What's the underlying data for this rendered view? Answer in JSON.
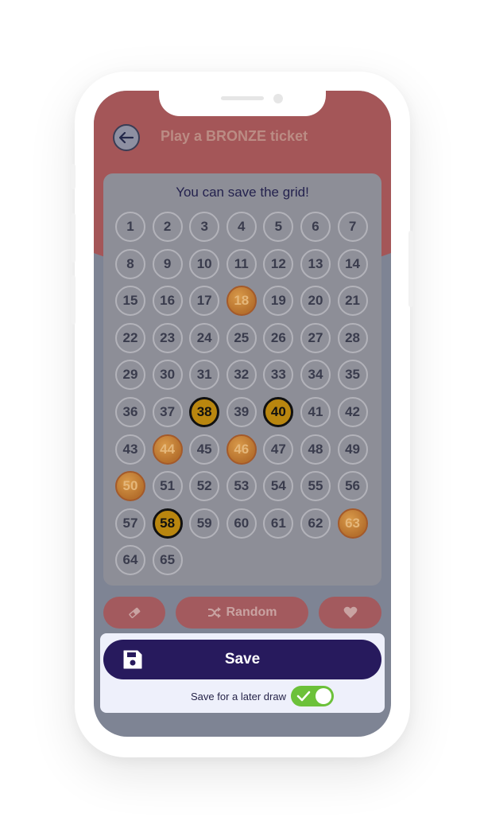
{
  "header": {
    "title_prefix": "Play a ",
    "title_emphasis": "BRONZE",
    "title_suffix": " ticket"
  },
  "grid": {
    "hint": "You can save the grid!",
    "numbers": [
      "1",
      "2",
      "3",
      "4",
      "5",
      "6",
      "7",
      "8",
      "9",
      "10",
      "11",
      "12",
      "13",
      "14",
      "15",
      "16",
      "17",
      "18",
      "19",
      "20",
      "21",
      "22",
      "23",
      "24",
      "25",
      "26",
      "27",
      "28",
      "29",
      "30",
      "31",
      "32",
      "33",
      "34",
      "35",
      "36",
      "37",
      "38",
      "39",
      "40",
      "41",
      "42",
      "43",
      "44",
      "45",
      "46",
      "47",
      "48",
      "49",
      "50",
      "51",
      "52",
      "53",
      "54",
      "55",
      "56",
      "57",
      "58",
      "59",
      "60",
      "61",
      "62",
      "63",
      "64",
      "65"
    ],
    "selected": [
      "38",
      "40",
      "58"
    ],
    "chance": [
      "18",
      "44",
      "46",
      "50",
      "63"
    ]
  },
  "actions": {
    "clear_icon": "eraser-icon",
    "random_label": "Random",
    "random_icon": "shuffle-icon",
    "favorite_icon": "heart-icon"
  },
  "save": {
    "label": "Save",
    "icon": "floppy-disk-icon",
    "later_label": "Save for a later draw",
    "later_enabled": true
  },
  "colors": {
    "primary": "#271a5d",
    "accent": "#a35a5e",
    "selected_ball": "#b9860f",
    "chance_ball": "#c98a3e",
    "toggle_on": "#6cc13a"
  }
}
